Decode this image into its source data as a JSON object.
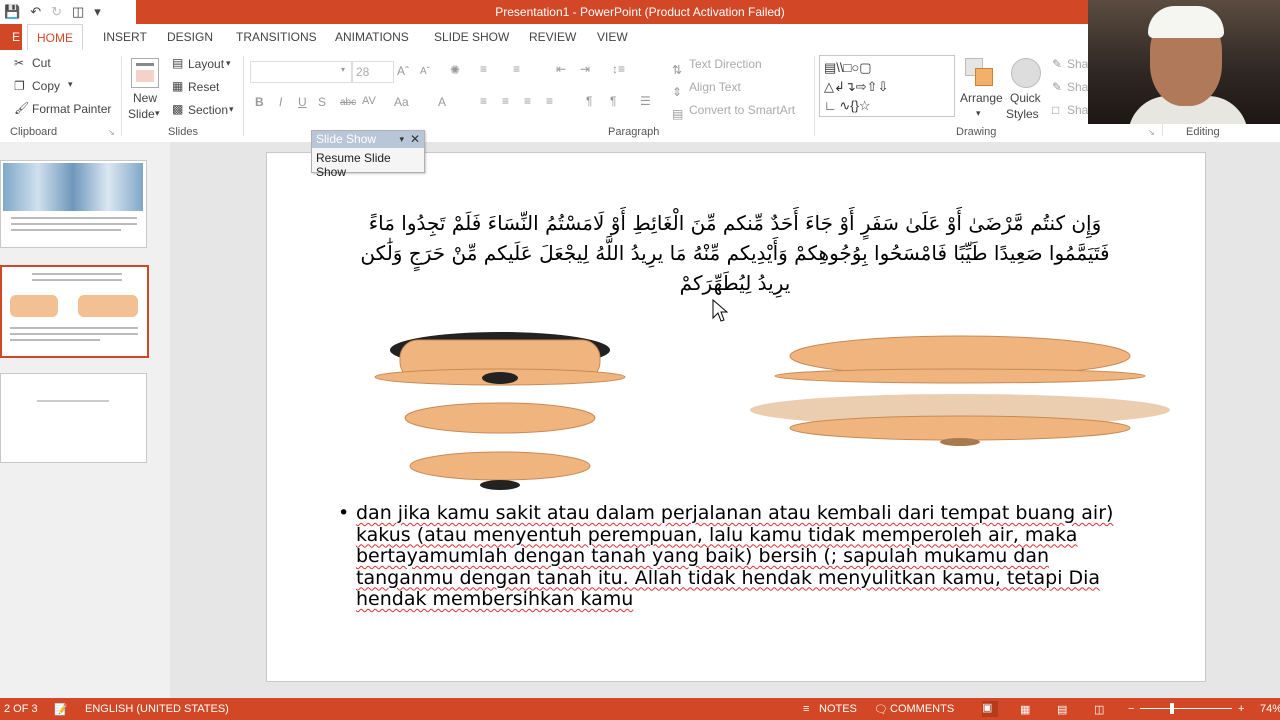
{
  "window": {
    "title": "Presentation1 - PowerPoint (Product Activation Failed)"
  },
  "tabs": {
    "file": "E",
    "home": "HOME",
    "insert": "INSERT",
    "design": "DESIGN",
    "transitions": "TRANSITIONS",
    "animations": "ANIMATIONS",
    "slide_show": "SLIDE SHOW",
    "review": "REVIEW",
    "view": "VIEW"
  },
  "ribbon": {
    "clipboard": {
      "cut": "Cut",
      "copy": "Copy",
      "format_painter": "Format Painter",
      "group": "Clipboard"
    },
    "slides": {
      "new_slide_line1": "New",
      "new_slide_line2": "Slide",
      "layout": "Layout",
      "reset": "Reset",
      "section": "Section",
      "group": "Slides"
    },
    "font": {
      "size": "28"
    },
    "paragraph": {
      "text_direction": "Text Direction",
      "align_text": "Align Text",
      "convert_smartart": "Convert to SmartArt",
      "group": "Paragraph"
    },
    "drawing": {
      "arrange": "Arrange",
      "quick_styles_line1": "Quick",
      "quick_styles_line2": "Styles",
      "shape_fill": "Sha",
      "shape_outline": "Sha",
      "shape_effects": "Sha",
      "group": "Drawing"
    },
    "editing": {
      "group": "Editing"
    }
  },
  "slideshow_toolbar": {
    "title": "Slide Show",
    "resume": "Resume Slide Show"
  },
  "slide": {
    "arabic_line1": "وَإِن كنتُم مَّرْضَىٰ أَوْ عَلَىٰ سَفَرٍ أَوْ جَاءَ أَحَدٌ مِّنكم مِّنَ الْغَائِطِ أَوْ لَامَسْتُمُ النِّسَاءَ فَلَمْ تَجِدُوا مَاءً",
    "arabic_line2": "فَتَيَمَّمُوا صَعِيدًا طَيِّبًا فَامْسَحُوا بِوُجُوهِكمْ وَأَيْدِيكم مِّنْهُ مَا يرِيدُ اللَّهُ لِيجْعَلَ عَلَيكم مِّنْ حَرَجٍ وَلَٰكن",
    "arabic_line3": "يرِيدُ لِيُطَهِّرَكمْ",
    "bullet_text": "dan jika kamu sakit atau dalam perjalanan atau kembali dari tempat buang air) kakus (atau menyentuh perempuan, lalu kamu tidak memperoleh air, maka bertayamumlah dengan tanah yang baik) bersih (; sapulah mukamu dan tanganmu dengan tanah itu. Allah tidak hendak menyulitkan kamu, tetapi Dia hendak membersihkan kamu"
  },
  "status": {
    "slide_counter": "2 OF 3",
    "language": "ENGLISH (UNITED STATES)",
    "notes": "NOTES",
    "comments": "COMMENTS",
    "zoom": "74%"
  },
  "colors": {
    "accent": "#d24726",
    "skin": "#f0b57f"
  }
}
